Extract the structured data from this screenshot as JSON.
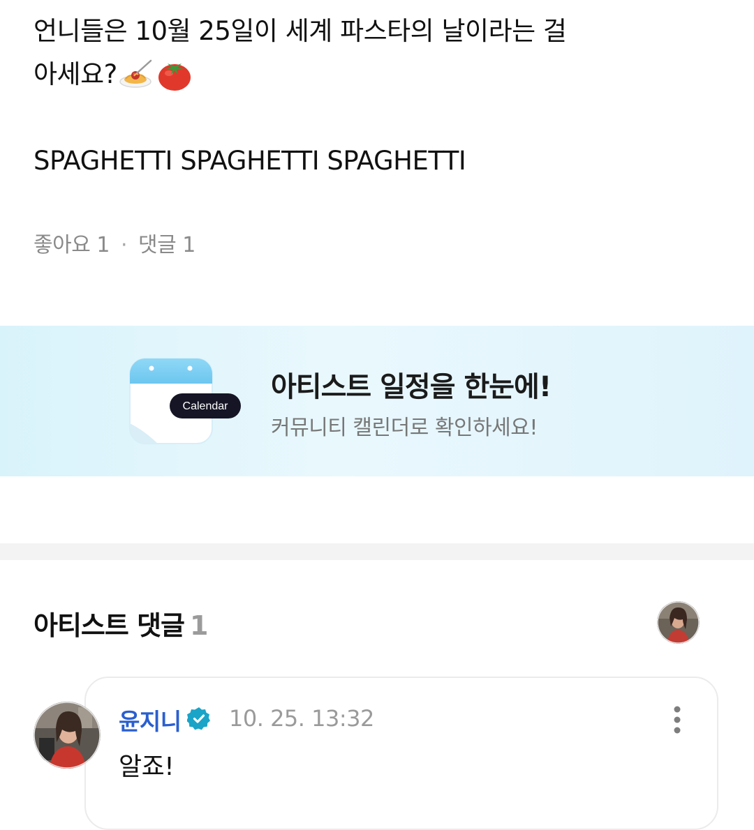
{
  "post": {
    "line1": "언니들은 10월 25일이 세계 파스타의 날이라는 걸",
    "line2": "아세요?",
    "line3": "SPAGHETTI SPAGHETTI SPAGHETTI"
  },
  "stats": {
    "likes": "좋아요 1",
    "comments": "댓글 1"
  },
  "banner": {
    "title": "아티스트 일정을 한눈에!",
    "subtitle": "커뮤니티 캘린더로 확인하세요!",
    "calendar_badge": "Calendar"
  },
  "artist_comments": {
    "title": "아티스트 댓글",
    "count": "1"
  },
  "comment": {
    "author": "윤지니",
    "time": "10. 25. 13:32",
    "text": "알죠!"
  },
  "colors": {
    "author_name": "#2a5fcf",
    "verified_badge": "#1aa4c8",
    "banner_bg": "#e6f7fd"
  },
  "icons": {
    "post_emoji_1": "spaghetti-emoji",
    "post_emoji_2": "tomato-emoji",
    "verified": "verified-badge-icon",
    "more": "more-vertical-icon"
  }
}
